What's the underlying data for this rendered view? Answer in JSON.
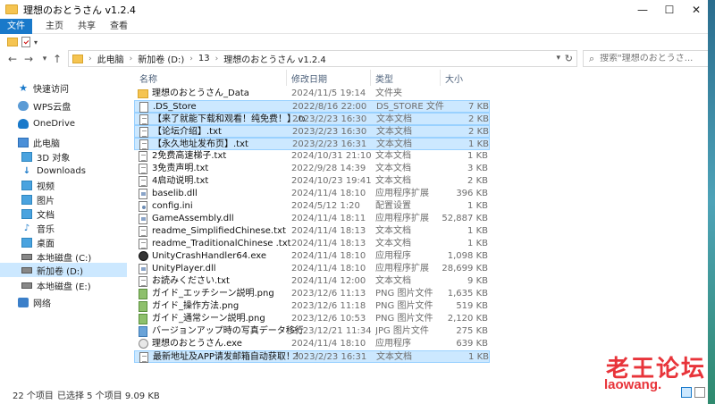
{
  "window": {
    "title": "理想のおとうさん v1.2.4"
  },
  "ribbon": {
    "tabs": [
      "文件",
      "主页",
      "共享",
      "查看"
    ]
  },
  "address": {
    "crumbs": [
      "此电脑",
      "新加卷 (D:)",
      "13",
      "理想のおとうさん v1.2.4"
    ],
    "search_placeholder": "搜索\"理想のおとうさ..."
  },
  "nav": {
    "items": [
      {
        "label": "快速访问",
        "icon": "pin-icon"
      },
      {
        "label": "WPS云盘",
        "icon": "wps-cloud-icon"
      },
      {
        "label": "OneDrive",
        "icon": "onedrive-icon"
      },
      {
        "label": "此电脑",
        "icon": "computer-icon"
      },
      {
        "label": "3D 对象",
        "icon": "3d-objects-icon"
      },
      {
        "label": "Downloads",
        "icon": "downloads-icon"
      },
      {
        "label": "视频",
        "icon": "videos-icon"
      },
      {
        "label": "图片",
        "icon": "pictures-icon"
      },
      {
        "label": "文档",
        "icon": "documents-icon"
      },
      {
        "label": "音乐",
        "icon": "music-icon"
      },
      {
        "label": "桌面",
        "icon": "desktop-icon"
      },
      {
        "label": "本地磁盘 (C:)",
        "icon": "drive-icon"
      },
      {
        "label": "新加卷 (D:)",
        "icon": "drive-icon"
      },
      {
        "label": "本地磁盘 (E:)",
        "icon": "drive-icon"
      },
      {
        "label": "网络",
        "icon": "network-icon"
      }
    ]
  },
  "columns": {
    "name": "名称",
    "date": "修改日期",
    "type": "类型",
    "size": "大小"
  },
  "files": [
    {
      "name": "理想のおとうさん_Data",
      "date": "2024/11/5 19:14",
      "type": "文件夹",
      "size": "",
      "icon": "folder",
      "selected": false
    },
    {
      "name": ".DS_Store",
      "date": "2022/8/16 22:00",
      "type": "DS_STORE 文件",
      "size": "7 KB",
      "icon": "ds",
      "selected": true
    },
    {
      "name": "【来了就能下载和观看！纯免费！】.txt",
      "date": "2023/2/23 16:30",
      "type": "文本文档",
      "size": "2 KB",
      "icon": "txt",
      "selected": true
    },
    {
      "name": "【论坛介绍】.txt",
      "date": "2023/2/23 16:30",
      "type": "文本文档",
      "size": "2 KB",
      "icon": "txt",
      "selected": true
    },
    {
      "name": "【永久地址发布页】.txt",
      "date": "2023/2/23 16:31",
      "type": "文本文档",
      "size": "1 KB",
      "icon": "txt",
      "selected": true
    },
    {
      "name": "2免费高速梯子.txt",
      "date": "2024/10/31 21:10",
      "type": "文本文档",
      "size": "1 KB",
      "icon": "txt",
      "selected": false
    },
    {
      "name": "3免责声明.txt",
      "date": "2022/9/28 14:39",
      "type": "文本文档",
      "size": "3 KB",
      "icon": "txt",
      "selected": false
    },
    {
      "name": "4启动说明.txt",
      "date": "2024/10/23 19:41",
      "type": "文本文档",
      "size": "2 KB",
      "icon": "txt",
      "selected": false
    },
    {
      "name": "baselib.dll",
      "date": "2024/11/4 18:10",
      "type": "应用程序扩展",
      "size": "396 KB",
      "icon": "dll",
      "selected": false
    },
    {
      "name": "config.ini",
      "date": "2024/5/12 1:20",
      "type": "配置设置",
      "size": "1 KB",
      "icon": "ini",
      "selected": false
    },
    {
      "name": "GameAssembly.dll",
      "date": "2024/11/4 18:11",
      "type": "应用程序扩展",
      "size": "52,887 KB",
      "icon": "dll",
      "selected": false
    },
    {
      "name": "readme_SimplifiedChinese.txt",
      "date": "2024/11/4 18:13",
      "type": "文本文档",
      "size": "1 KB",
      "icon": "txt",
      "selected": false
    },
    {
      "name": "readme_TraditionalChinese .txt",
      "date": "2024/11/4 18:13",
      "type": "文本文档",
      "size": "1 KB",
      "icon": "txt",
      "selected": false
    },
    {
      "name": "UnityCrashHandler64.exe",
      "date": "2024/11/4 18:10",
      "type": "应用程序",
      "size": "1,098 KB",
      "icon": "unity",
      "selected": false
    },
    {
      "name": "UnityPlayer.dll",
      "date": "2024/11/4 18:10",
      "type": "应用程序扩展",
      "size": "28,699 KB",
      "icon": "dll",
      "selected": false
    },
    {
      "name": "お読みください.txt",
      "date": "2024/11/4 12:00",
      "type": "文本文档",
      "size": "9 KB",
      "icon": "txt",
      "selected": false
    },
    {
      "name": "ガイド_エッチシーン説明.png",
      "date": "2023/12/6 11:13",
      "type": "PNG 图片文件",
      "size": "1,635 KB",
      "icon": "png",
      "selected": false
    },
    {
      "name": "ガイド_操作方法.png",
      "date": "2023/12/6 11:18",
      "type": "PNG 图片文件",
      "size": "519 KB",
      "icon": "png",
      "selected": false
    },
    {
      "name": "ガイド_通常シーン説明.png",
      "date": "2023/12/6 10:53",
      "type": "PNG 图片文件",
      "size": "2,120 KB",
      "icon": "png",
      "selected": false
    },
    {
      "name": "バージョンアップ時の写真データ移行方...",
      "date": "2023/12/21 11:34",
      "type": "JPG 图片文件",
      "size": "275 KB",
      "icon": "jpg",
      "selected": false
    },
    {
      "name": "理想のおとうさん.exe",
      "date": "2024/11/4 18:10",
      "type": "应用程序",
      "size": "639 KB",
      "icon": "exe",
      "selected": false
    },
    {
      "name": "最新地址及APP请发邮箱自动获取！！！....",
      "date": "2023/2/23 16:31",
      "type": "文本文档",
      "size": "1 KB",
      "icon": "txt",
      "selected": true
    }
  ],
  "status": {
    "count": "22 个项目",
    "selected": "已选择 5 个项目  9.09 KB"
  },
  "watermark": {
    "line1": "老王论坛",
    "line2": "laowang."
  }
}
